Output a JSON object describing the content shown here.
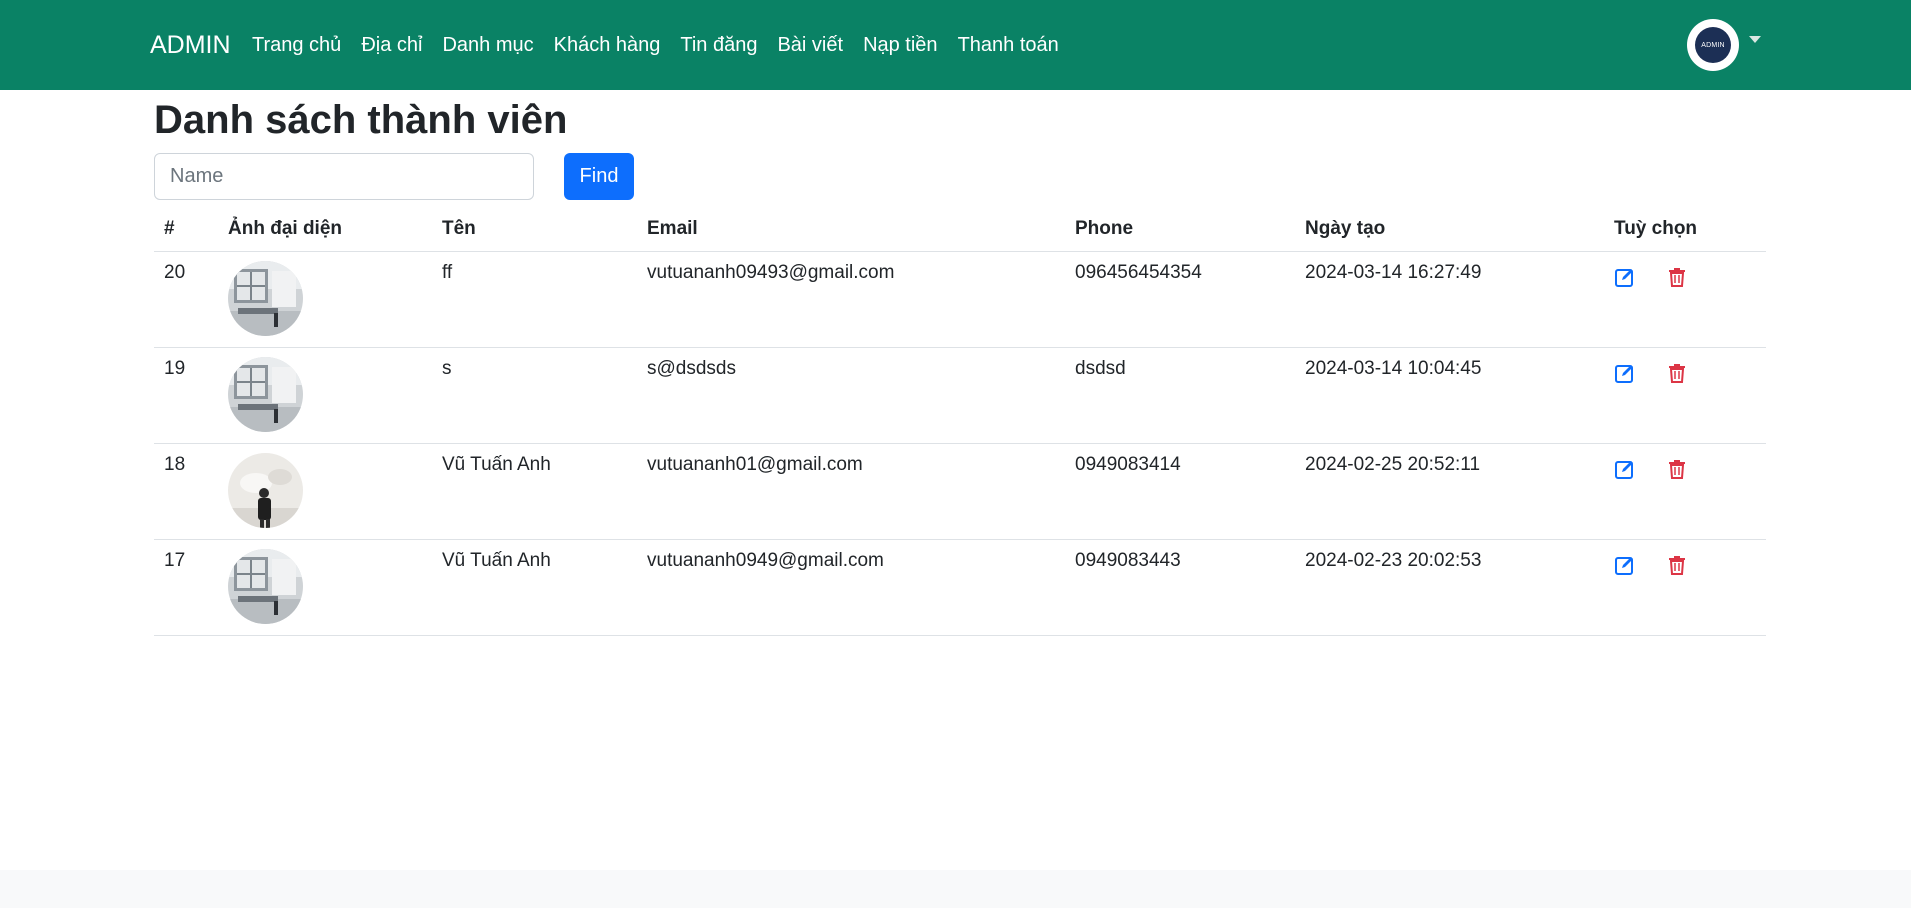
{
  "navbar": {
    "brand": "ADMIN",
    "links": [
      "Trang chủ",
      "Địa chỉ",
      "Danh mục",
      "Khách hàng",
      "Tin đăng",
      "Bài viết",
      "Nạp tiền",
      "Thanh toán"
    ],
    "avatar_text": "ADMIN"
  },
  "page": {
    "title": "Danh sách thành viên"
  },
  "search": {
    "placeholder": "Name",
    "value": "",
    "button_label": "Find"
  },
  "table": {
    "headers": [
      "#",
      "Ảnh đại diện",
      "Tên",
      "Email",
      "Phone",
      "Ngày tạo",
      "Tuỳ chọn"
    ],
    "rows": [
      {
        "id": "20",
        "name": "ff",
        "email": "vutuananh09493@gmail.com",
        "phone": "096456454354",
        "created": "2024-03-14 16:27:49",
        "photo": "room-interior"
      },
      {
        "id": "19",
        "name": "s",
        "email": "s@dsdsds",
        "phone": "dsdsd",
        "created": "2024-03-14 10:04:45",
        "photo": "room-interior"
      },
      {
        "id": "18",
        "name": "Vũ Tuấn Anh",
        "email": "vutuananh01@gmail.com",
        "phone": "0949083414",
        "created": "2024-02-25 20:52:11",
        "photo": "person-white-room"
      },
      {
        "id": "17",
        "name": "Vũ Tuấn Anh",
        "email": "vutuananh0949@gmail.com",
        "phone": "0949083443",
        "created": "2024-02-23 20:02:53",
        "photo": "room-interior"
      }
    ]
  },
  "colors": {
    "navbar": "#0a8265",
    "primary": "#0d6efd",
    "danger": "#dc3545"
  },
  "icons": {
    "edit": "edit-icon",
    "delete": "trash-icon"
  }
}
